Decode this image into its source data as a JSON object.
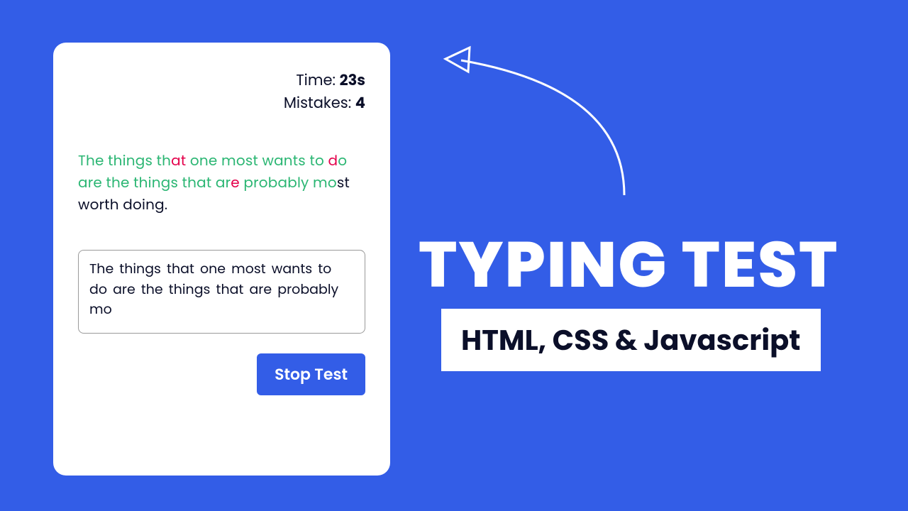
{
  "stats": {
    "time_label": "Time: ",
    "time_value": "23s",
    "mistakes_label": "Mistakes: ",
    "mistakes_value": "4"
  },
  "quote": {
    "seg1": "The things th",
    "seg2": "at",
    "seg3": " one most wants to ",
    "seg4": "d",
    "seg5": "o are the things that ar",
    "seg6": "e",
    "seg7": " probably mo",
    "seg8": "st worth doing."
  },
  "input": {
    "value": "The things that one most wants to do are the things that are probably mo"
  },
  "button": {
    "stop": "Stop Test"
  },
  "hero": {
    "title": "TYPING TEST",
    "subtitle": "HTML, CSS & Javascript"
  }
}
